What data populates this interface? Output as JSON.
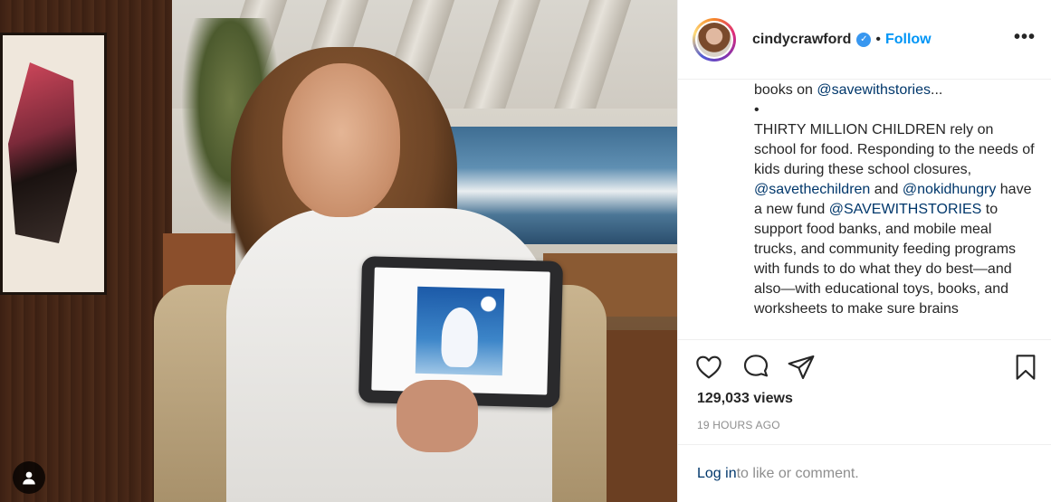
{
  "post": {
    "username": "cindycrawford",
    "verified_mark": "✓",
    "separator": "•",
    "follow_label": "Follow",
    "more_label": "•••"
  },
  "caption": {
    "line_prefix": "books on ",
    "line_mention": "@savewithstories",
    "line_suffix": "...",
    "bullet": "•",
    "p1": "THIRTY MILLION CHILDREN rely on school for food. Responding to the needs of kids during these school closures, ",
    "mention_save_children": "@savethechildren",
    "and_text": " and",
    "mention_nokid": "@nokidhungry",
    "p2": " have a new fund",
    "mention_savewithstories": "@SAVEWITHSTORIES",
    "p3": " to support food banks, and mobile meal trucks, and community feeding programs with funds to do what they do best—and also—with educational toys, books, and worksheets to make sure brains"
  },
  "actions": {
    "like_icon": "heart-icon",
    "comment_icon": "comment-icon",
    "share_icon": "share-icon",
    "save_icon": "bookmark-icon"
  },
  "stats": {
    "views": "129,033 views",
    "time": "19 HOURS AGO"
  },
  "login": {
    "link": "Log in",
    "rest": " to like or comment."
  },
  "colors": {
    "accent": "#0095f6",
    "mention": "#00376b",
    "muted": "#8e8e8e"
  }
}
